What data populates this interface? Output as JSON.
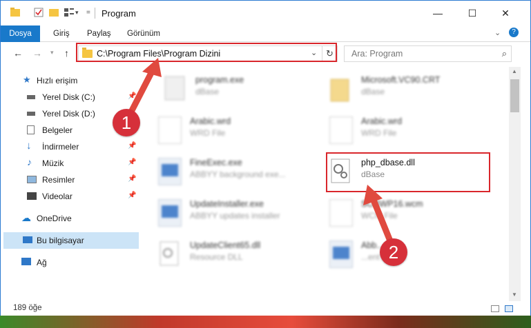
{
  "titlebar": {
    "title": "Program",
    "minimize_icon": "minimize-icon",
    "maximize_icon": "maximize-icon",
    "close_icon": "close-icon"
  },
  "ribbon": {
    "tabs": [
      {
        "label": "Dosya"
      },
      {
        "label": "Giriş"
      },
      {
        "label": "Paylaş"
      },
      {
        "label": "Görünüm"
      }
    ]
  },
  "navigation": {
    "address": "C:\\Program Files\\Program Dizini",
    "search_placeholder": "Ara: Program"
  },
  "sidebar": {
    "items": [
      {
        "label": "Hızlı erişim",
        "icon": "star-icon"
      },
      {
        "label": "Yerel Disk (C:)",
        "icon": "drive-icon"
      },
      {
        "label": "Yerel Disk (D:)",
        "icon": "drive-icon"
      },
      {
        "label": "Belgeler",
        "icon": "documents-icon"
      },
      {
        "label": "İndirmeler",
        "icon": "download-icon"
      },
      {
        "label": "Müzik",
        "icon": "music-icon"
      },
      {
        "label": "Resimler",
        "icon": "pictures-icon"
      },
      {
        "label": "Videolar",
        "icon": "videos-icon"
      },
      {
        "label": "OneDrive",
        "icon": "cloud-icon"
      },
      {
        "label": "Bu bilgisayar",
        "icon": "computer-icon"
      },
      {
        "label": "Ağ",
        "icon": "network-icon"
      }
    ]
  },
  "files": [
    {
      "name": "program.exe",
      "type": "dBase"
    },
    {
      "name": "Microsoft.VC90.CRT",
      "type": "dBase"
    },
    {
      "name": "Arabic.wrd",
      "type": "WRD File"
    },
    {
      "name": "Arabic.wrd",
      "type": "WRD File"
    },
    {
      "name": "FineExec.exe",
      "type": "ABBYY background exe..."
    },
    {
      "name": "php_dbase.dll",
      "type": "dBase"
    },
    {
      "name": "UpdateInstaller.exe",
      "type": "ABBYY updates installer"
    },
    {
      "name": "SOBWP16.wcm",
      "type": "WCM File"
    },
    {
      "name": "UpdateClient65.dll",
      "type": "Resource DLL"
    },
    {
      "name": "Abb...exe",
      "type": "...ent hand..."
    }
  ],
  "status": {
    "count": "189 öğe"
  },
  "annotations": {
    "badge1": "1",
    "badge2": "2"
  },
  "colors": {
    "accent": "#1979ca",
    "highlight": "#d9262b"
  }
}
